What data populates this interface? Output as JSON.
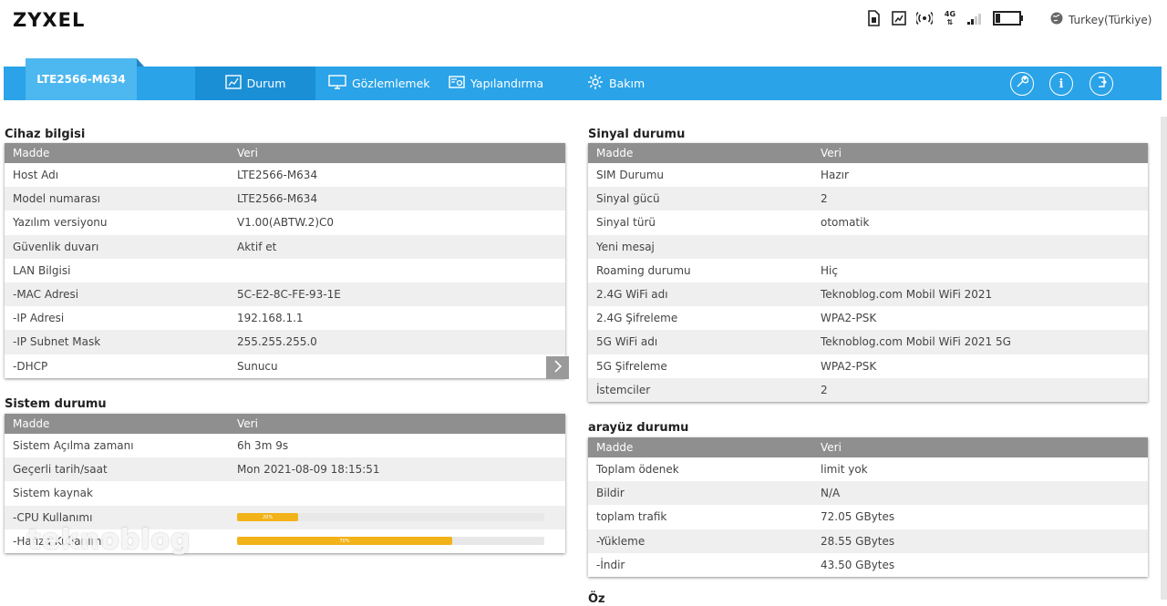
{
  "brand": "ZYXEL",
  "language": "Turkey(Türkiye)",
  "network_type": "4G",
  "nav": {
    "device": "LTE2566-M634",
    "items": [
      "Durum",
      "Gözlemlemek",
      "Yapılandırma",
      "Bakım"
    ]
  },
  "device_info": {
    "title": "Cihaz bilgisi",
    "col1": "Madde",
    "col2": "Veri",
    "rows": [
      {
        "k": "Host Adı",
        "v": "LTE2566-M634"
      },
      {
        "k": "Model numarası",
        "v": "LTE2566-M634"
      },
      {
        "k": "Yazılım versiyonu",
        "v": "V1.00(ABTW.2)C0"
      },
      {
        "k": "Güvenlik duvarı",
        "v": "Aktif et"
      },
      {
        "k": "LAN Bilgisi",
        "v": ""
      },
      {
        "k": "-MAC Adresi",
        "v": "5C-E2-8C-FE-93-1E"
      },
      {
        "k": "-IP Adresi",
        "v": "192.168.1.1"
      },
      {
        "k": "-IP Subnet Mask",
        "v": "255.255.255.0"
      },
      {
        "k": "-DHCP",
        "v": "Sunucu"
      }
    ]
  },
  "system_status": {
    "title": "Sistem durumu",
    "col1": "Madde",
    "col2": "Veri",
    "rows": [
      {
        "k": "Sistem Açılma zamanı",
        "v": "6h 3m 9s"
      },
      {
        "k": "Geçerli tarih/saat",
        "v": "Mon 2021-08-09 18:15:51"
      },
      {
        "k": "Sistem kaynak",
        "v": ""
      },
      {
        "k": "-CPU Kullanımı",
        "v": ""
      },
      {
        "k": "-Hafıza Kullanımı",
        "v": ""
      }
    ],
    "cpu_usage": 0.2,
    "memory_usage": 0.7,
    "cpu_label": "20%",
    "memory_label": "70%"
  },
  "signal_status": {
    "title": "Sinyal durumu",
    "col1": "Madde",
    "col2": "Veri",
    "rows": [
      {
        "k": "SIM Durumu",
        "v": "Hazır"
      },
      {
        "k": "Sinyal gücü",
        "v": "2"
      },
      {
        "k": "Sinyal türü",
        "v": "otomatik"
      },
      {
        "k": "Yeni mesaj",
        "v": ""
      },
      {
        "k": "Roaming durumu",
        "v": "Hiç"
      },
      {
        "k": "2.4G WiFi adı",
        "v": "Teknoblog.com Mobil WiFi 2021"
      },
      {
        "k": "2.4G Şifreleme",
        "v": "WPA2-PSK"
      },
      {
        "k": "5G WiFi adı",
        "v": "Teknoblog.com Mobil WiFi 2021 5G"
      },
      {
        "k": "5G Şifreleme",
        "v": "WPA2-PSK"
      },
      {
        "k": "İstemciler",
        "v": "2"
      }
    ]
  },
  "interface_status": {
    "title": "arayüz durumu",
    "col1": "Madde",
    "col2": "Veri",
    "rows": [
      {
        "k": "Toplam ödenek",
        "v": "limit yok"
      },
      {
        "k": "Bildir",
        "v": "N/A"
      },
      {
        "k": "toplam trafik",
        "v": "72.05 GBytes"
      },
      {
        "k": "-Yükleme",
        "v": "28.55 GBytes"
      },
      {
        "k": "-İndir",
        "v": "43.50 GBytes"
      }
    ]
  },
  "next_section_title": "Öz",
  "watermark": "teknoblog",
  "colors": {
    "nav": "#2aa3e8",
    "device_tab": "#4db7f0",
    "bar": "#f2b31a",
    "table_head": "#8f8f8f"
  }
}
